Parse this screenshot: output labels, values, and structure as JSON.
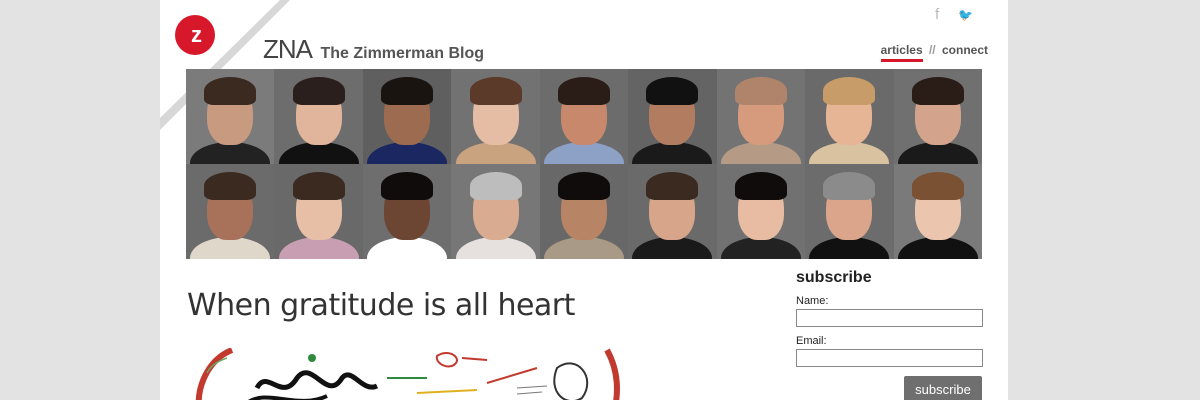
{
  "header": {
    "logo_letter": "z",
    "brand_short": "ZNA",
    "brand_name": "The Zimmerman Blog",
    "social": {
      "facebook": "f",
      "twitter": "🐦"
    },
    "nav": [
      {
        "label": "articles",
        "active": true
      },
      {
        "label": "connect",
        "active": false
      }
    ],
    "nav_separator": "//"
  },
  "colors": {
    "accent": "#d7182a",
    "page_bg": "#e3e3e3",
    "banner_bg": "#6b6b6b"
  },
  "banner": {
    "faces": [
      {
        "bg": "#7b7b7b",
        "skin": "#c89a80",
        "hair": "#3a2a20",
        "shirt": "#222"
      },
      {
        "bg": "#6d6d6d",
        "skin": "#e0b59b",
        "hair": "#2a1f1c",
        "shirt": "#111"
      },
      {
        "bg": "#5f5f5f",
        "skin": "#9d6c50",
        "hair": "#1a1410",
        "shirt": "#1a2760"
      },
      {
        "bg": "#727272",
        "skin": "#e5bca4",
        "hair": "#5b3a2a",
        "shirt": "#c9a27f"
      },
      {
        "bg": "#6c6c6c",
        "skin": "#c8886c",
        "hair": "#2a1c16",
        "shirt": "#8da0c6"
      },
      {
        "bg": "#646464",
        "skin": "#b27c60",
        "hair": "#111",
        "shirt": "#1a1a1a"
      },
      {
        "bg": "#737373",
        "skin": "#d69a7d",
        "hair": "#b0846a",
        "shirt": "#b59b85"
      },
      {
        "bg": "#6a6a6a",
        "skin": "#e6b596",
        "hair": "#c89c68",
        "shirt": "#d9c29f"
      },
      {
        "bg": "#707070",
        "skin": "#d3a48b",
        "hair": "#2a1c16",
        "shirt": "#1a1a1a"
      },
      {
        "bg": "#6b6b6b",
        "skin": "#a8715a",
        "hair": "#3a2a20",
        "shirt": "#e0d7cb"
      },
      {
        "bg": "#696969",
        "skin": "#e7bfa6",
        "hair": "#3a2a1f",
        "shirt": "#c89fb2"
      },
      {
        "bg": "#6e6e6e",
        "skin": "#6d4633",
        "hair": "#0f0c0b",
        "shirt": "#fff"
      },
      {
        "bg": "#777777",
        "skin": "#d9ab90",
        "hair": "#bdbdbd",
        "shirt": "#e6e1de"
      },
      {
        "bg": "#686868",
        "skin": "#b88466",
        "hair": "#0f0c0b",
        "shirt": "#a89a86"
      },
      {
        "bg": "#6a6a6a",
        "skin": "#d7a68a",
        "hair": "#3b2a1f",
        "shirt": "#1a1a1a"
      },
      {
        "bg": "#717171",
        "skin": "#e7bca2",
        "hair": "#0f0c0b",
        "shirt": "#222"
      },
      {
        "bg": "#6c6c6c",
        "skin": "#dba58b",
        "hair": "#8b8b8b",
        "shirt": "#111"
      },
      {
        "bg": "#7a7a7a",
        "skin": "#ebc5ad",
        "hair": "#7a5233",
        "shirt": "#111"
      }
    ]
  },
  "article": {
    "title": "When gratitude is all heart"
  },
  "subscribe": {
    "heading": "subscribe",
    "name_label": "Name:",
    "email_label": "Email:",
    "name_value": "",
    "email_value": "",
    "button_label": "subscribe"
  }
}
